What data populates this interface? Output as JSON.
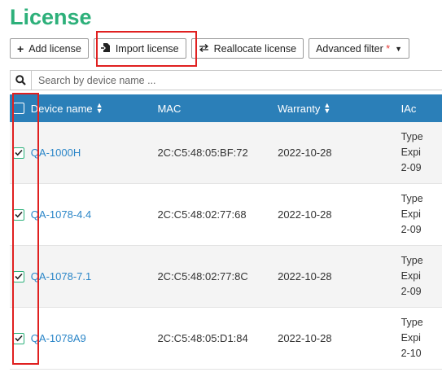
{
  "page": {
    "title": "License"
  },
  "toolbar": {
    "add_label": "Add license",
    "import_label": "Import license",
    "reallocate_label": "Reallocate license",
    "filter_label": "Advanced filter",
    "filter_star": "*"
  },
  "search": {
    "placeholder": "Search by device name ..."
  },
  "table": {
    "headers": {
      "device_name": "Device name",
      "mac": "MAC",
      "warranty": "Warranty",
      "iac": "IAc"
    },
    "rows": [
      {
        "checked": true,
        "device": "QA-1000H",
        "mac": "2C:C5:48:05:BF:72",
        "warranty": "2022-10-28",
        "type_lines": [
          "Type",
          "Expi",
          "2-09"
        ]
      },
      {
        "checked": true,
        "device": "QA-1078-4.4",
        "mac": "2C:C5:48:02:77:68",
        "warranty": "2022-10-28",
        "type_lines": [
          "Type",
          "Expi",
          "2-09"
        ]
      },
      {
        "checked": true,
        "device": "QA-1078-7.1",
        "mac": "2C:C5:48:02:77:8C",
        "warranty": "2022-10-28",
        "type_lines": [
          "Type",
          "Expi",
          "2-09"
        ]
      },
      {
        "checked": true,
        "device": "QA-1078A9",
        "mac": "2C:C5:48:05:D1:84",
        "warranty": "2022-10-28",
        "type_lines": [
          "Type",
          "Expi",
          "2-10"
        ]
      }
    ]
  },
  "colors": {
    "accent_green": "#2db07a",
    "header_blue": "#2b7fb8",
    "link_blue": "#2b86c8",
    "highlight_red": "#e02020"
  },
  "icons": {
    "add": "plus-icon",
    "import": "import-icon",
    "reallocate": "swap-arrows-icon",
    "search": "search-icon",
    "filter": "caret-down-icon",
    "sort": "sort-icon",
    "check": "check-icon"
  }
}
